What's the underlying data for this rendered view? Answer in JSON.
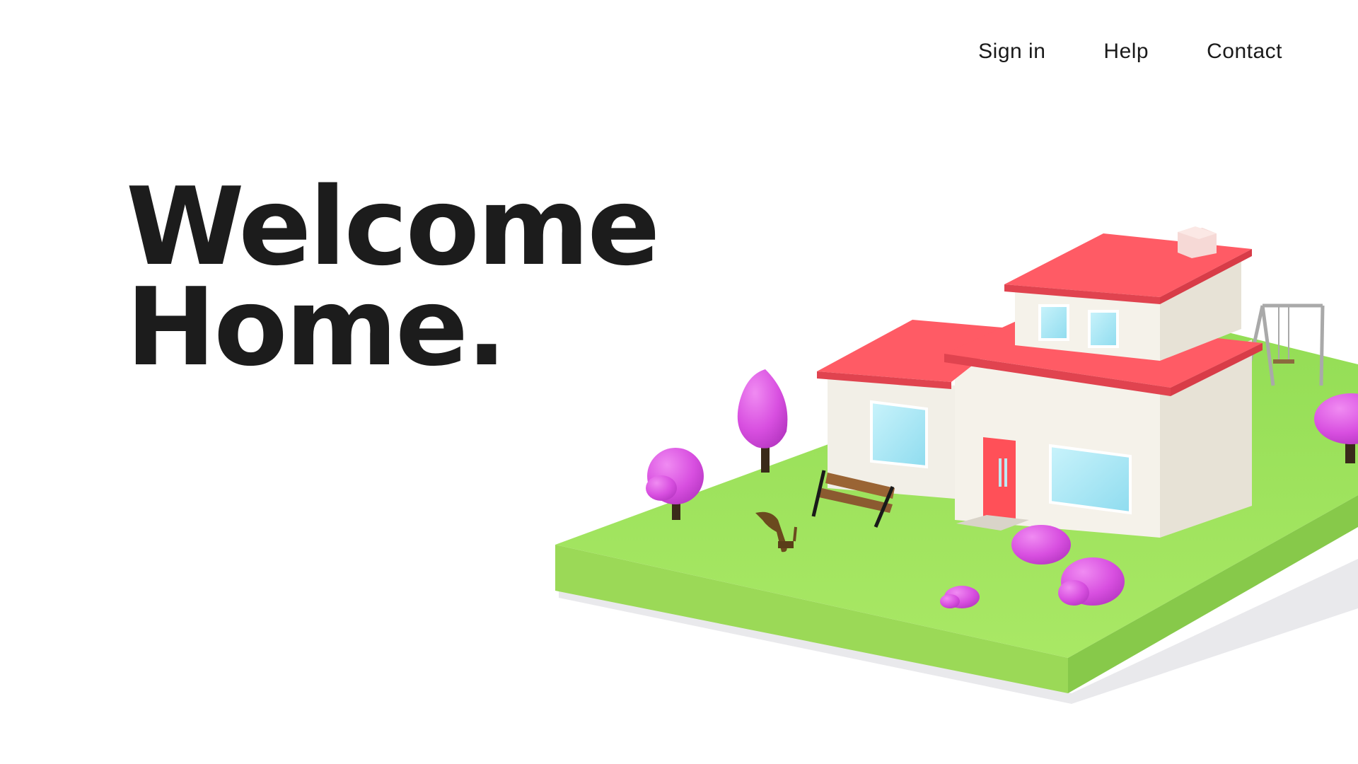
{
  "nav": {
    "sign_in": "Sign in",
    "help": "Help",
    "contact": "Contact"
  },
  "hero": {
    "line1": "Welcome",
    "line2": "Home."
  },
  "illustration": {
    "name": "isometric-house-scene",
    "colors": {
      "grass_top": "#9be15a",
      "grass_side": "#8fd24d",
      "roof": "#ff5b65",
      "walls": "#f3f0e8",
      "window": "#a6e6f5",
      "door": "#ff5058",
      "foliage": "#d94fe0",
      "trunk": "#3a2a1a"
    }
  }
}
